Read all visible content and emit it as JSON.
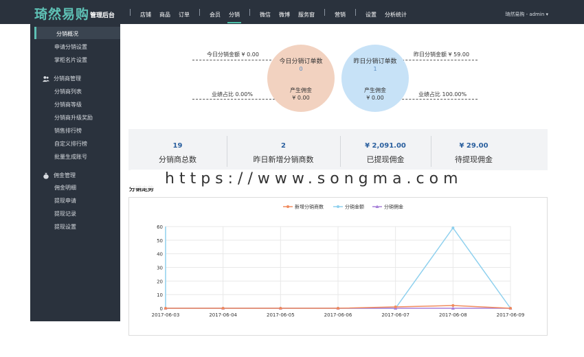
{
  "header": {
    "logo": "琦然易购",
    "logo_sub": "管理后台",
    "nav": [
      {
        "label": "店铺"
      },
      {
        "label": "商品"
      },
      {
        "label": "订单"
      },
      {
        "label": "会员"
      },
      {
        "label": "分销",
        "active": true
      },
      {
        "label": "微信"
      },
      {
        "label": "微博"
      },
      {
        "label": "服务窗"
      },
      {
        "label": "营销"
      },
      {
        "label": "设置"
      },
      {
        "label": "分析统计"
      }
    ],
    "user": "琦然易购 - admin ▾"
  },
  "sidebar": {
    "top_items": [
      "分销概况",
      "申请分销设置",
      "掌柜名片设置"
    ],
    "group1": {
      "title": "分销商管理",
      "items": [
        "分销商列表",
        "分销商等级",
        "分销商升级奖励",
        "销售排行榜",
        "自定义排行榜",
        "批量生成账号"
      ]
    },
    "group2": {
      "title": "佣金管理",
      "items": [
        "佣金明细",
        "提现申请",
        "提现记录",
        "提现设置"
      ]
    }
  },
  "overview": {
    "today_amount": "今日分销金额 ¥ 0.00",
    "today_ratio": "业绩占比 0.00%",
    "yesterday_amount": "昨日分销金额 ¥ 59.00",
    "yesterday_ratio": "业绩占比 100.00%",
    "today_circle": {
      "title": "今日分销订单数",
      "count": "0",
      "label": "产生佣金",
      "value": "¥ 0.00"
    },
    "yesterday_circle": {
      "title": "昨日分销订单数",
      "count": "1",
      "label": "产生佣金",
      "value": "¥ 0.00"
    }
  },
  "stats": [
    {
      "value": "19",
      "label": "分销商总数"
    },
    {
      "value": "2",
      "label": "昨日新增分销商数"
    },
    {
      "value": "¥ 2,091.00",
      "label": "已提现佣金"
    },
    {
      "value": "¥ 29.00",
      "label": "待提现佣金"
    }
  ],
  "watermark": "https://www.songma.com",
  "trend_title": "分销走势",
  "colors": {
    "orange": "#f08a5d",
    "blue": "#8ed0ee",
    "purple": "#a77fd8",
    "accent": "#5ec1b5"
  },
  "chart_data": {
    "type": "line",
    "x": [
      "2017-06-03",
      "2017-06-04",
      "2017-06-05",
      "2017-06-06",
      "2017-06-07",
      "2017-06-08",
      "2017-06-09"
    ],
    "series": [
      {
        "name": "新增分销商数",
        "values": [
          0,
          0,
          0,
          0,
          1,
          2,
          0
        ],
        "color": "#f08a5d"
      },
      {
        "name": "分销金额",
        "values": [
          0,
          0,
          0,
          0,
          0,
          59,
          0
        ],
        "color": "#8ed0ee"
      },
      {
        "name": "分销佣金",
        "values": [
          0,
          0,
          0,
          0,
          0,
          0,
          0
        ],
        "color": "#a77fd8"
      }
    ],
    "ylim": [
      0,
      60
    ],
    "yticks": [
      0,
      10,
      20,
      30,
      40,
      50,
      60
    ],
    "grid": true,
    "legend": "top-center"
  }
}
